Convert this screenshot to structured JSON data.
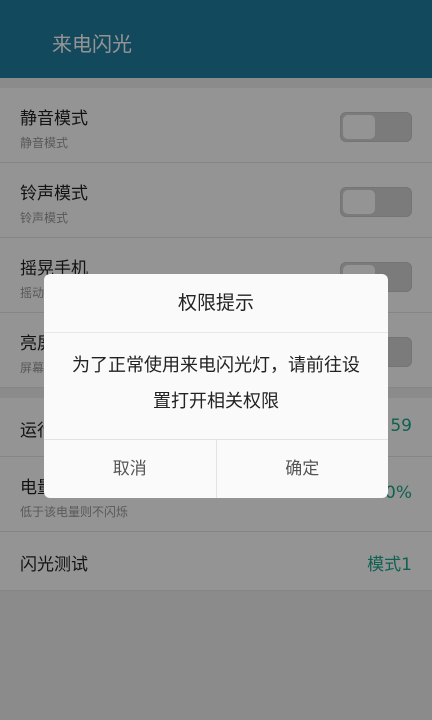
{
  "header": {
    "title": "来电闪光"
  },
  "settings": {
    "toggles": [
      {
        "label": "静音模式",
        "sub": "静音模式",
        "on": false
      },
      {
        "label": "铃声模式",
        "sub": "铃声模式",
        "on": false
      },
      {
        "label": "摇晃手机",
        "sub": "摇动",
        "on": false
      },
      {
        "label": "亮屏",
        "sub": "屏幕",
        "on": false
      }
    ],
    "runtime": {
      "label": "运行",
      "value": "59"
    },
    "battery": {
      "label": "电量",
      "sub": "低于该电量则不闪烁",
      "value": "10%"
    },
    "test": {
      "label": "闪光测试",
      "value": "模式1"
    }
  },
  "dialog": {
    "title": "权限提示",
    "message": "为了正常使用来电闪光灯，请前往设置打开相关权限",
    "cancel_label": "取消",
    "confirm_label": "确定"
  }
}
